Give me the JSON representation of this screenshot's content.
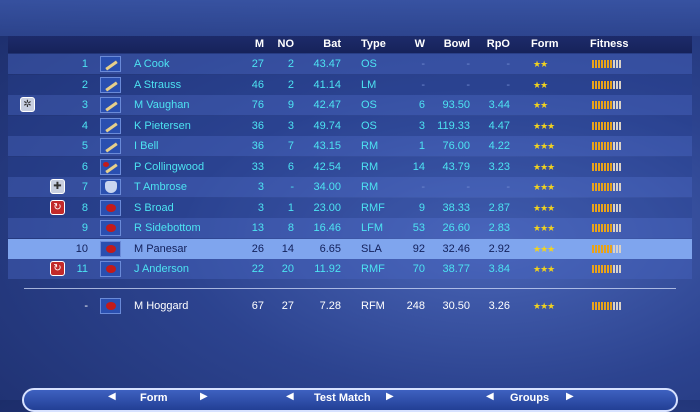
{
  "columns": {
    "m": "M",
    "no": "NO",
    "bat": "Bat",
    "type": "Type",
    "w": "W",
    "bowl": "Bowl",
    "rpo": "RpO",
    "form": "Form",
    "fitness": "Fitness"
  },
  "players": [
    {
      "num": "1",
      "name": "A Cook",
      "m": "27",
      "no": "2",
      "bat": "43.47",
      "type": "OS",
      "w": "-",
      "bowl": "-",
      "rpo": "-",
      "role": "bat",
      "badge": "",
      "form": "★★",
      "fit": 7
    },
    {
      "num": "2",
      "name": "A Strauss",
      "m": "46",
      "no": "2",
      "bat": "41.14",
      "type": "LM",
      "w": "-",
      "bowl": "-",
      "rpo": "-",
      "role": "bat",
      "badge": "",
      "form": "★★",
      "fit": 7
    },
    {
      "num": "3",
      "name": "M Vaughan",
      "m": "76",
      "no": "9",
      "bat": "42.47",
      "type": "OS",
      "w": "6",
      "bowl": "93.50",
      "rpo": "3.44",
      "role": "bat",
      "badge": "captain",
      "form": "★★",
      "fit": 7
    },
    {
      "num": "4",
      "name": "K Pietersen",
      "m": "36",
      "no": "3",
      "bat": "49.74",
      "type": "OS",
      "w": "3",
      "bowl": "119.33",
      "rpo": "4.47",
      "role": "bat",
      "badge": "",
      "form": "★★★",
      "fit": 7
    },
    {
      "num": "5",
      "name": "I Bell",
      "m": "36",
      "no": "7",
      "bat": "43.15",
      "type": "RM",
      "w": "1",
      "bowl": "76.00",
      "rpo": "4.22",
      "role": "bat",
      "badge": "",
      "form": "★★★",
      "fit": 7
    },
    {
      "num": "6",
      "name": "P Collingwood",
      "m": "33",
      "no": "6",
      "bat": "42.54",
      "type": "RM",
      "w": "14",
      "bowl": "43.79",
      "rpo": "3.23",
      "role": "allround",
      "badge": "",
      "form": "★★★",
      "fit": 7
    },
    {
      "num": "7",
      "name": "T Ambrose",
      "m": "3",
      "no": "-",
      "bat": "34.00",
      "type": "RM",
      "w": "-",
      "bowl": "-",
      "rpo": "-",
      "role": "keeper",
      "badge": "keeper",
      "form": "★★★",
      "fit": 7
    },
    {
      "num": "8",
      "name": "S Broad",
      "m": "3",
      "no": "1",
      "bat": "23.00",
      "type": "RMF",
      "w": "9",
      "bowl": "38.33",
      "rpo": "2.87",
      "role": "bowl",
      "badge": "red",
      "form": "★★★",
      "fit": 7
    },
    {
      "num": "9",
      "name": "R Sidebottom",
      "m": "13",
      "no": "8",
      "bat": "16.46",
      "type": "LFM",
      "w": "53",
      "bowl": "26.60",
      "rpo": "2.83",
      "role": "bowl",
      "badge": "",
      "form": "★★★",
      "fit": 7
    },
    {
      "num": "10",
      "name": "M Panesar",
      "m": "26",
      "no": "14",
      "bat": "6.65",
      "type": "SLA",
      "w": "92",
      "bowl": "32.46",
      "rpo": "2.92",
      "role": "bowl",
      "badge": "",
      "form": "★★★",
      "fit": 7,
      "selected": true
    },
    {
      "num": "11",
      "name": "J Anderson",
      "m": "22",
      "no": "20",
      "bat": "11.92",
      "type": "RMF",
      "w": "70",
      "bowl": "38.77",
      "rpo": "3.84",
      "role": "bowl",
      "badge": "red",
      "form": "★★★",
      "fit": 7
    }
  ],
  "reserve": {
    "num": "-",
    "name": "M Hoggard",
    "m": "67",
    "no": "27",
    "bat": "7.28",
    "type": "RFM",
    "w": "248",
    "bowl": "30.50",
    "rpo": "3.26",
    "role": "bowl",
    "form": "★★★",
    "fit": 7
  },
  "bottom_nav": {
    "left": "Form",
    "center": "Test Match",
    "right": "Groups"
  },
  "colors": {
    "player_text": "#4de3f2",
    "selected_row": "#7fa5ee",
    "stars": "#f1d21f",
    "fitness": "#e9a31a"
  }
}
